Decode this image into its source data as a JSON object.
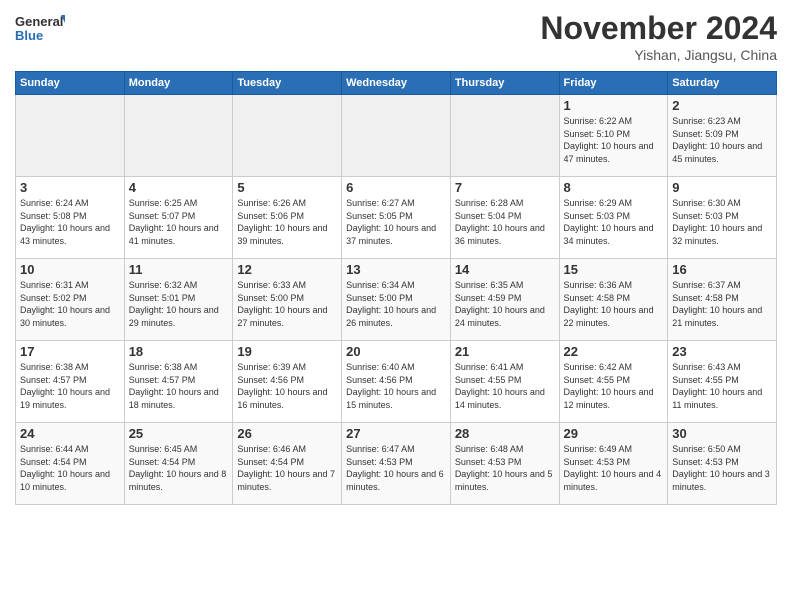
{
  "logo": {
    "general": "General",
    "blue": "Blue"
  },
  "title": "November 2024",
  "location": "Yishan, Jiangsu, China",
  "weekdays": [
    "Sunday",
    "Monday",
    "Tuesday",
    "Wednesday",
    "Thursday",
    "Friday",
    "Saturday"
  ],
  "weeks": [
    [
      {
        "day": "",
        "empty": true
      },
      {
        "day": "",
        "empty": true
      },
      {
        "day": "",
        "empty": true
      },
      {
        "day": "",
        "empty": true
      },
      {
        "day": "",
        "empty": true
      },
      {
        "day": "1",
        "sunrise": "Sunrise: 6:22 AM",
        "sunset": "Sunset: 5:10 PM",
        "daylight": "Daylight: 10 hours and 47 minutes."
      },
      {
        "day": "2",
        "sunrise": "Sunrise: 6:23 AM",
        "sunset": "Sunset: 5:09 PM",
        "daylight": "Daylight: 10 hours and 45 minutes."
      }
    ],
    [
      {
        "day": "3",
        "sunrise": "Sunrise: 6:24 AM",
        "sunset": "Sunset: 5:08 PM",
        "daylight": "Daylight: 10 hours and 43 minutes."
      },
      {
        "day": "4",
        "sunrise": "Sunrise: 6:25 AM",
        "sunset": "Sunset: 5:07 PM",
        "daylight": "Daylight: 10 hours and 41 minutes."
      },
      {
        "day": "5",
        "sunrise": "Sunrise: 6:26 AM",
        "sunset": "Sunset: 5:06 PM",
        "daylight": "Daylight: 10 hours and 39 minutes."
      },
      {
        "day": "6",
        "sunrise": "Sunrise: 6:27 AM",
        "sunset": "Sunset: 5:05 PM",
        "daylight": "Daylight: 10 hours and 37 minutes."
      },
      {
        "day": "7",
        "sunrise": "Sunrise: 6:28 AM",
        "sunset": "Sunset: 5:04 PM",
        "daylight": "Daylight: 10 hours and 36 minutes."
      },
      {
        "day": "8",
        "sunrise": "Sunrise: 6:29 AM",
        "sunset": "Sunset: 5:03 PM",
        "daylight": "Daylight: 10 hours and 34 minutes."
      },
      {
        "day": "9",
        "sunrise": "Sunrise: 6:30 AM",
        "sunset": "Sunset: 5:03 PM",
        "daylight": "Daylight: 10 hours and 32 minutes."
      }
    ],
    [
      {
        "day": "10",
        "sunrise": "Sunrise: 6:31 AM",
        "sunset": "Sunset: 5:02 PM",
        "daylight": "Daylight: 10 hours and 30 minutes."
      },
      {
        "day": "11",
        "sunrise": "Sunrise: 6:32 AM",
        "sunset": "Sunset: 5:01 PM",
        "daylight": "Daylight: 10 hours and 29 minutes."
      },
      {
        "day": "12",
        "sunrise": "Sunrise: 6:33 AM",
        "sunset": "Sunset: 5:00 PM",
        "daylight": "Daylight: 10 hours and 27 minutes."
      },
      {
        "day": "13",
        "sunrise": "Sunrise: 6:34 AM",
        "sunset": "Sunset: 5:00 PM",
        "daylight": "Daylight: 10 hours and 26 minutes."
      },
      {
        "day": "14",
        "sunrise": "Sunrise: 6:35 AM",
        "sunset": "Sunset: 4:59 PM",
        "daylight": "Daylight: 10 hours and 24 minutes."
      },
      {
        "day": "15",
        "sunrise": "Sunrise: 6:36 AM",
        "sunset": "Sunset: 4:58 PM",
        "daylight": "Daylight: 10 hours and 22 minutes."
      },
      {
        "day": "16",
        "sunrise": "Sunrise: 6:37 AM",
        "sunset": "Sunset: 4:58 PM",
        "daylight": "Daylight: 10 hours and 21 minutes."
      }
    ],
    [
      {
        "day": "17",
        "sunrise": "Sunrise: 6:38 AM",
        "sunset": "Sunset: 4:57 PM",
        "daylight": "Daylight: 10 hours and 19 minutes."
      },
      {
        "day": "18",
        "sunrise": "Sunrise: 6:38 AM",
        "sunset": "Sunset: 4:57 PM",
        "daylight": "Daylight: 10 hours and 18 minutes."
      },
      {
        "day": "19",
        "sunrise": "Sunrise: 6:39 AM",
        "sunset": "Sunset: 4:56 PM",
        "daylight": "Daylight: 10 hours and 16 minutes."
      },
      {
        "day": "20",
        "sunrise": "Sunrise: 6:40 AM",
        "sunset": "Sunset: 4:56 PM",
        "daylight": "Daylight: 10 hours and 15 minutes."
      },
      {
        "day": "21",
        "sunrise": "Sunrise: 6:41 AM",
        "sunset": "Sunset: 4:55 PM",
        "daylight": "Daylight: 10 hours and 14 minutes."
      },
      {
        "day": "22",
        "sunrise": "Sunrise: 6:42 AM",
        "sunset": "Sunset: 4:55 PM",
        "daylight": "Daylight: 10 hours and 12 minutes."
      },
      {
        "day": "23",
        "sunrise": "Sunrise: 6:43 AM",
        "sunset": "Sunset: 4:55 PM",
        "daylight": "Daylight: 10 hours and 11 minutes."
      }
    ],
    [
      {
        "day": "24",
        "sunrise": "Sunrise: 6:44 AM",
        "sunset": "Sunset: 4:54 PM",
        "daylight": "Daylight: 10 hours and 10 minutes."
      },
      {
        "day": "25",
        "sunrise": "Sunrise: 6:45 AM",
        "sunset": "Sunset: 4:54 PM",
        "daylight": "Daylight: 10 hours and 8 minutes."
      },
      {
        "day": "26",
        "sunrise": "Sunrise: 6:46 AM",
        "sunset": "Sunset: 4:54 PM",
        "daylight": "Daylight: 10 hours and 7 minutes."
      },
      {
        "day": "27",
        "sunrise": "Sunrise: 6:47 AM",
        "sunset": "Sunset: 4:53 PM",
        "daylight": "Daylight: 10 hours and 6 minutes."
      },
      {
        "day": "28",
        "sunrise": "Sunrise: 6:48 AM",
        "sunset": "Sunset: 4:53 PM",
        "daylight": "Daylight: 10 hours and 5 minutes."
      },
      {
        "day": "29",
        "sunrise": "Sunrise: 6:49 AM",
        "sunset": "Sunset: 4:53 PM",
        "daylight": "Daylight: 10 hours and 4 minutes."
      },
      {
        "day": "30",
        "sunrise": "Sunrise: 6:50 AM",
        "sunset": "Sunset: 4:53 PM",
        "daylight": "Daylight: 10 hours and 3 minutes."
      }
    ]
  ]
}
